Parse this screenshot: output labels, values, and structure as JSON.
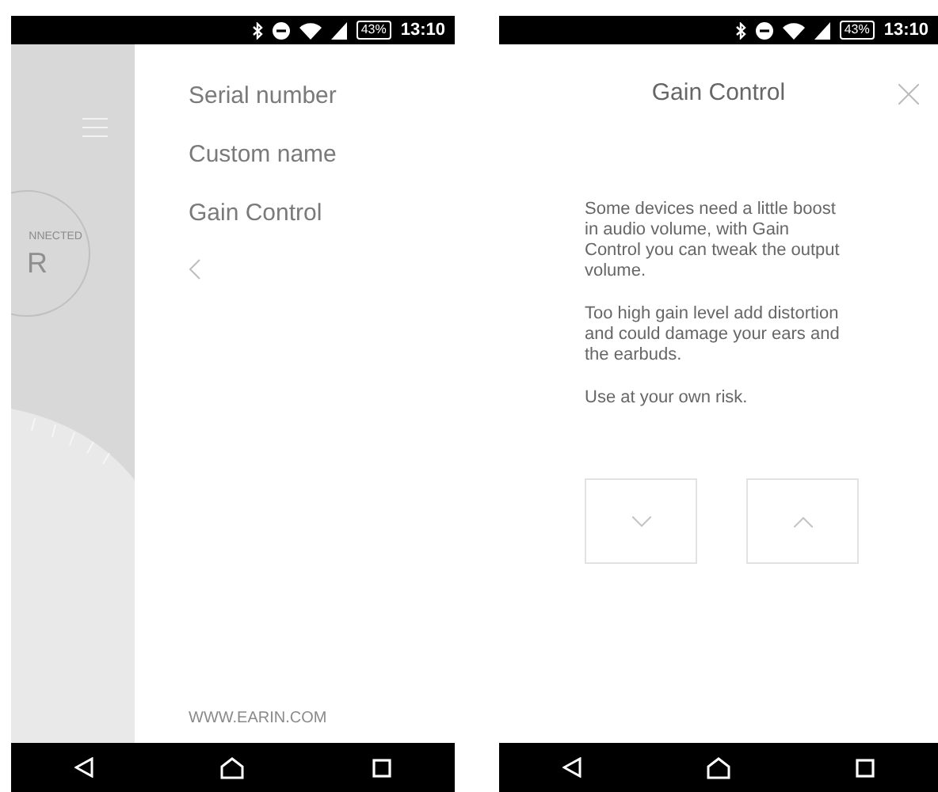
{
  "screens": [
    {
      "kind": "menu",
      "status_bar": {
        "battery": "43%",
        "time": "13:10"
      },
      "sidebar": {
        "badge_text": "NNECTED",
        "badge_letter": "R"
      },
      "menu_items": [
        {
          "label": "Serial number"
        },
        {
          "label": "Custom name"
        },
        {
          "label": "Gain Control"
        }
      ],
      "footer": "WWW.EARIN.COM"
    },
    {
      "kind": "dialog",
      "status_bar": {
        "battery": "43%",
        "time": "13:10"
      },
      "title": "Gain Control",
      "paragraphs": [
        "Some devices need a little boost in audio volume, with Gain Control you can tweak the output volume.",
        "Too high gain level add distortion and could damage your ears and the earbuds.",
        "Use at your own risk."
      ]
    }
  ]
}
